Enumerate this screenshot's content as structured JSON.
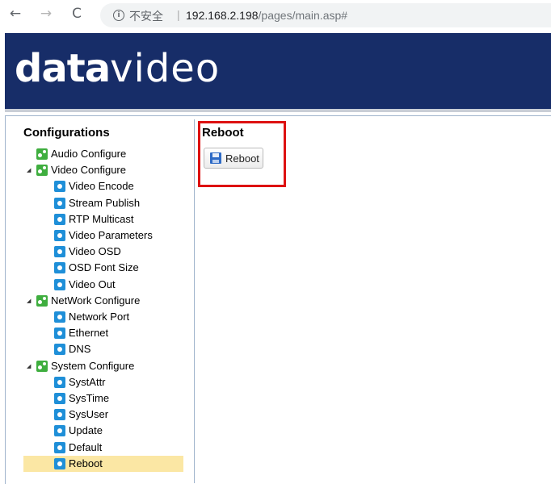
{
  "browser": {
    "back_glyph": "←",
    "forward_glyph": "→",
    "reload_glyph": "C",
    "info_glyph": "i",
    "insecure_label": "不安全",
    "separator": "|",
    "url_host": "192.168.2.198",
    "url_path": "/pages/main.asp#"
  },
  "header": {
    "logo_bold": "data",
    "logo_light": "video",
    "background": "#172d68"
  },
  "sidebar": {
    "title": "Configurations",
    "items": [
      {
        "label": "Audio Configure",
        "type": "group",
        "expanded": false
      },
      {
        "label": "Video Configure",
        "type": "group",
        "expanded": true
      },
      {
        "label": "Video Encode",
        "type": "leaf"
      },
      {
        "label": "Stream Publish",
        "type": "leaf"
      },
      {
        "label": "RTP Multicast",
        "type": "leaf"
      },
      {
        "label": "Video Parameters",
        "type": "leaf"
      },
      {
        "label": "Video OSD",
        "type": "leaf"
      },
      {
        "label": "OSD Font Size",
        "type": "leaf"
      },
      {
        "label": "Video Out",
        "type": "leaf"
      },
      {
        "label": "NetWork Configure",
        "type": "group",
        "expanded": true
      },
      {
        "label": "Network Port",
        "type": "leaf"
      },
      {
        "label": "Ethernet",
        "type": "leaf"
      },
      {
        "label": "DNS",
        "type": "leaf"
      },
      {
        "label": "System Configure",
        "type": "group",
        "expanded": true
      },
      {
        "label": "SystAttr",
        "type": "leaf"
      },
      {
        "label": "SysTime",
        "type": "leaf"
      },
      {
        "label": "SysUser",
        "type": "leaf"
      },
      {
        "label": "Update",
        "type": "leaf"
      },
      {
        "label": "Default",
        "type": "leaf"
      },
      {
        "label": "Reboot",
        "type": "leaf",
        "selected": true
      }
    ],
    "expand_glyph": "◢",
    "selected_color": "#fbe7a4"
  },
  "content": {
    "title": "Reboot",
    "reboot_button_label": "Reboot",
    "highlight_color": "#dd1111"
  }
}
